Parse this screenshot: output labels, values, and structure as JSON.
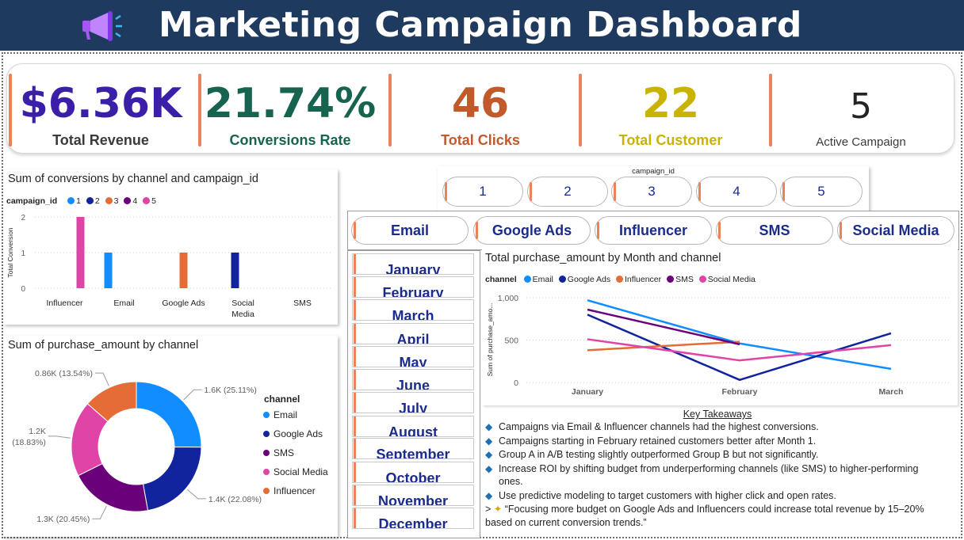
{
  "header": {
    "title": "Marketing Campaign Dashboard",
    "logo_icon": "megaphone-icon"
  },
  "kpis": [
    {
      "value": "$6.36K",
      "label": "Total Revenue",
      "value_color": "#3c1fa8",
      "label_color": "#3b3b3b"
    },
    {
      "value": "21.74%",
      "label": "Conversions Rate",
      "value_color": "#166450",
      "label_color": "#166450"
    },
    {
      "value": "46",
      "label": "Total Clicks",
      "value_color": "#c2592a",
      "label_color": "#c2592a"
    },
    {
      "value": "22",
      "label": "Total Customer",
      "value_color": "#c8b400",
      "label_color": "#c8b400"
    },
    {
      "value": "5",
      "label": "Active Campaign",
      "value_color": "#252423",
      "label_color": "#3b3b3b"
    }
  ],
  "campaign_slicer": {
    "title": "campaign_id",
    "items": [
      "1",
      "2",
      "3",
      "4",
      "5"
    ]
  },
  "channel_slicer": {
    "items": [
      "Email",
      "Google Ads",
      "Influencer",
      "SMS",
      "Social Media"
    ]
  },
  "month_slicer": {
    "items": [
      "January",
      "February",
      "March",
      "April",
      "May",
      "June",
      "July",
      "August",
      "September",
      "October",
      "November",
      "December"
    ]
  },
  "colors": {
    "1": "#118dff",
    "2": "#12239e",
    "3": "#e66c37",
    "4": "#6b007b",
    "5": "#e044a7"
  },
  "chart_data": [
    {
      "type": "bar",
      "title": "Sum of conversions by channel and campaign_id",
      "legend_title": "campaign_id",
      "legend": [
        "1",
        "2",
        "3",
        "4",
        "5"
      ],
      "xlabel": "",
      "ylabel": "Total Conversion",
      "ylim": [
        0,
        2
      ],
      "yticks": [
        "0",
        "1",
        "2"
      ],
      "categories": [
        "Influencer",
        "Email",
        "Google Ads",
        "Social Media",
        "SMS"
      ],
      "series": [
        {
          "name": "1",
          "color": "#118dff",
          "values": [
            0,
            1,
            0,
            0,
            0
          ]
        },
        {
          "name": "2",
          "color": "#12239e",
          "values": [
            0,
            0,
            0,
            1,
            0
          ]
        },
        {
          "name": "3",
          "color": "#e66c37",
          "values": [
            0,
            0,
            1,
            0,
            0
          ]
        },
        {
          "name": "4",
          "color": "#6b007b",
          "values": [
            0,
            0,
            0,
            0,
            0
          ]
        },
        {
          "name": "5",
          "color": "#e044a7",
          "values": [
            2,
            0,
            0,
            0,
            0
          ]
        }
      ],
      "grid": true
    },
    {
      "type": "pie",
      "title": "Sum of purchase_amount by channel",
      "legend_title": "channel",
      "slices": [
        {
          "name": "Email",
          "value": 1.6,
          "label": "1.6K (25.11%)",
          "color": "#118dff"
        },
        {
          "name": "Google Ads",
          "value": 1.4,
          "label": "1.4K (22.08%)",
          "color": "#12239e"
        },
        {
          "name": "SMS",
          "value": 1.3,
          "label": "1.3K (20.45%)",
          "color": "#6b007b"
        },
        {
          "name": "Social Media",
          "value": 1.2,
          "label": "1.2K\n(18.83%)",
          "color": "#e044a7"
        },
        {
          "name": "Influencer",
          "value": 0.86,
          "label": "0.86K (13.54%)",
          "color": "#e66c37"
        }
      ],
      "percents": [
        25.11,
        22.08,
        20.45,
        18.83,
        13.54
      ]
    },
    {
      "type": "line",
      "title": "Total purchase_amount by Month and channel",
      "legend_title": "channel",
      "x": [
        "January",
        "February",
        "March"
      ],
      "ylabel": "Sum of purchase_amo...",
      "ylim": [
        0,
        1000
      ],
      "yticks": [
        "0",
        "500",
        "1,000"
      ],
      "series": [
        {
          "name": "Email",
          "color": "#118dff",
          "values": [
            970,
            460,
            160
          ]
        },
        {
          "name": "Google Ads",
          "color": "#12239e",
          "values": [
            800,
            30,
            580
          ]
        },
        {
          "name": "Influencer",
          "color": "#e66c37",
          "values": [
            380,
            480,
            null
          ]
        },
        {
          "name": "SMS",
          "color": "#6b007b",
          "values": [
            860,
            450,
            null
          ]
        },
        {
          "name": "Social Media",
          "color": "#e044a7",
          "values": [
            510,
            260,
            440
          ]
        }
      ],
      "grid": true
    }
  ],
  "takeaways": {
    "title": "Key Takeaways",
    "items": [
      "Campaigns via Email & Influencer channels had the highest conversions.",
      "Campaigns starting in February retained customers better after Month 1.",
      "Group A in A/B testing slightly outperformed Group B but not significantly.",
      "Increase ROI by shifting budget from underperforming channels (like SMS) to higher-performing ones.",
      "Use predictive modeling to target customers with higher click and open rates."
    ],
    "quote_prefix": ">",
    "quote": "“Focusing more budget on Google Ads and Influencers could increase total revenue by 15–20% based on current conversion trends.”"
  }
}
